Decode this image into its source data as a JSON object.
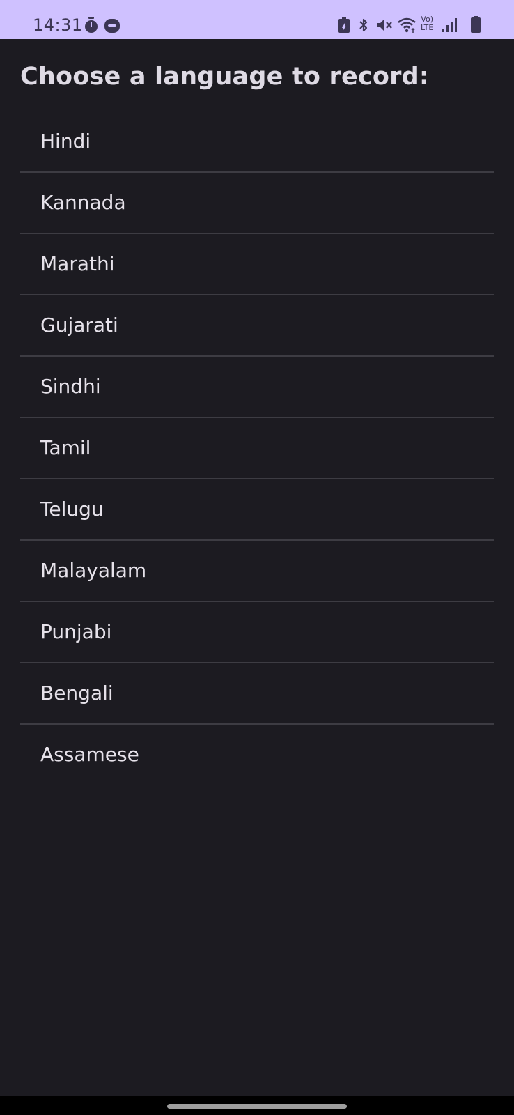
{
  "status_bar": {
    "time": "14:31",
    "network_label_top": "Vo)",
    "network_label_bottom": "LTE",
    "icons": [
      "timer-icon",
      "notification-pill-icon",
      "battery-saver-icon",
      "bluetooth-icon",
      "mute-icon",
      "wifi-icon",
      "volte-icon",
      "signal-icon",
      "battery-icon"
    ],
    "background": "#cfc1ff"
  },
  "main": {
    "heading": "Choose a language to record:",
    "languages": [
      {
        "label": "Hindi"
      },
      {
        "label": "Kannada"
      },
      {
        "label": "Marathi"
      },
      {
        "label": "Gujarati"
      },
      {
        "label": "Sindhi"
      },
      {
        "label": "Tamil"
      },
      {
        "label": "Telugu"
      },
      {
        "label": "Malayalam"
      },
      {
        "label": "Punjabi"
      },
      {
        "label": "Bengali"
      },
      {
        "label": "Assamese"
      }
    ]
  },
  "colors": {
    "background": "#1c1b21",
    "divider": "#3d3c43",
    "text": "#e6e2ea"
  }
}
